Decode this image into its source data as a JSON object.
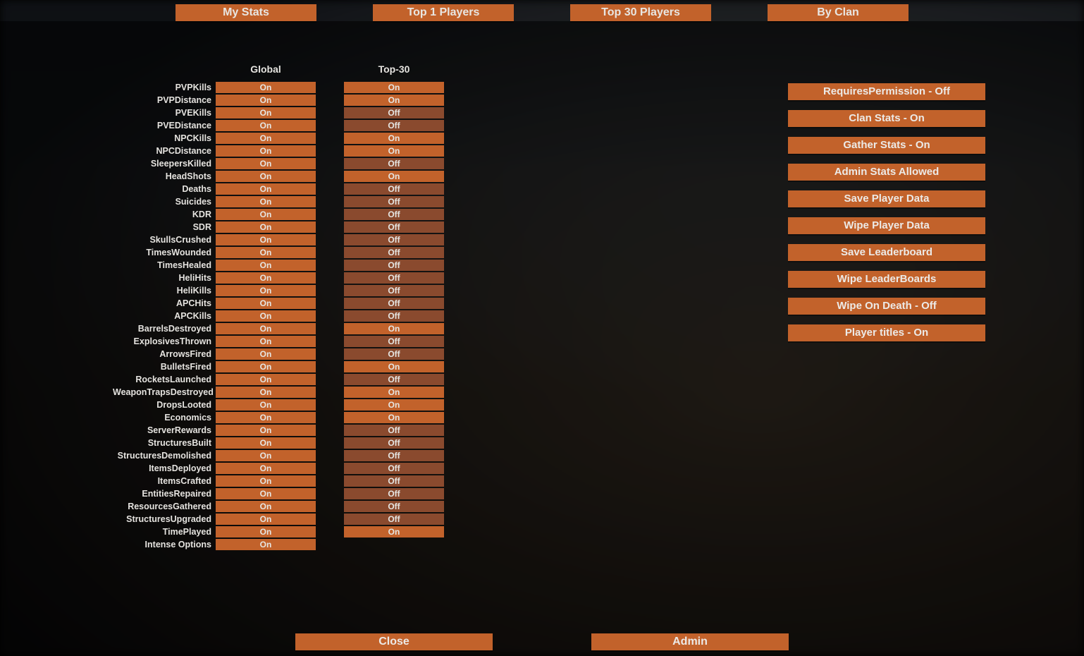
{
  "tabs": [
    {
      "id": "my-stats",
      "label": "My Stats"
    },
    {
      "id": "top-1",
      "label": "Top 1 Players"
    },
    {
      "id": "top-30",
      "label": "Top 30 Players"
    },
    {
      "id": "by-clan",
      "label": "By Clan"
    }
  ],
  "columns": {
    "global": "Global",
    "top30": "Top-30"
  },
  "stats": [
    {
      "name": "PVPKills",
      "global": "On",
      "top30": "On"
    },
    {
      "name": "PVPDistance",
      "global": "On",
      "top30": "On"
    },
    {
      "name": "PVEKills",
      "global": "On",
      "top30": "Off"
    },
    {
      "name": "PVEDistance",
      "global": "On",
      "top30": "Off"
    },
    {
      "name": "NPCKills",
      "global": "On",
      "top30": "On"
    },
    {
      "name": "NPCDistance",
      "global": "On",
      "top30": "On"
    },
    {
      "name": "SleepersKilled",
      "global": "On",
      "top30": "Off"
    },
    {
      "name": "HeadShots",
      "global": "On",
      "top30": "On"
    },
    {
      "name": "Deaths",
      "global": "On",
      "top30": "Off"
    },
    {
      "name": "Suicides",
      "global": "On",
      "top30": "Off"
    },
    {
      "name": "KDR",
      "global": "On",
      "top30": "Off"
    },
    {
      "name": "SDR",
      "global": "On",
      "top30": "Off"
    },
    {
      "name": "SkullsCrushed",
      "global": "On",
      "top30": "Off"
    },
    {
      "name": "TimesWounded",
      "global": "On",
      "top30": "Off"
    },
    {
      "name": "TimesHealed",
      "global": "On",
      "top30": "Off"
    },
    {
      "name": "HeliHits",
      "global": "On",
      "top30": "Off"
    },
    {
      "name": "HeliKills",
      "global": "On",
      "top30": "Off"
    },
    {
      "name": "APCHits",
      "global": "On",
      "top30": "Off"
    },
    {
      "name": "APCKills",
      "global": "On",
      "top30": "Off"
    },
    {
      "name": "BarrelsDestroyed",
      "global": "On",
      "top30": "On"
    },
    {
      "name": "ExplosivesThrown",
      "global": "On",
      "top30": "Off"
    },
    {
      "name": "ArrowsFired",
      "global": "On",
      "top30": "Off"
    },
    {
      "name": "BulletsFired",
      "global": "On",
      "top30": "On"
    },
    {
      "name": "RocketsLaunched",
      "global": "On",
      "top30": "Off"
    },
    {
      "name": "WeaponTrapsDestroyed",
      "global": "On",
      "top30": "On"
    },
    {
      "name": "DropsLooted",
      "global": "On",
      "top30": "On"
    },
    {
      "name": "Economics",
      "global": "On",
      "top30": "On"
    },
    {
      "name": "ServerRewards",
      "global": "On",
      "top30": "Off"
    },
    {
      "name": "StructuresBuilt",
      "global": "On",
      "top30": "Off"
    },
    {
      "name": "StructuresDemolished",
      "global": "On",
      "top30": "Off"
    },
    {
      "name": "ItemsDeployed",
      "global": "On",
      "top30": "Off"
    },
    {
      "name": "ItemsCrafted",
      "global": "On",
      "top30": "Off"
    },
    {
      "name": "EntitiesRepaired",
      "global": "On",
      "top30": "Off"
    },
    {
      "name": "ResourcesGathered",
      "global": "On",
      "top30": "Off"
    },
    {
      "name": "StructuresUpgraded",
      "global": "On",
      "top30": "Off"
    },
    {
      "name": "TimePlayed",
      "global": "On",
      "top30": "On"
    },
    {
      "name": "Intense Options",
      "global": "On",
      "top30": null
    }
  ],
  "admin_buttons": [
    {
      "id": "requires-permission",
      "label": "RequiresPermission - Off"
    },
    {
      "id": "clan-stats",
      "label": "Clan Stats - On"
    },
    {
      "id": "gather-stats",
      "label": "Gather Stats - On"
    },
    {
      "id": "admin-stats",
      "label": "Admin Stats Allowed"
    },
    {
      "id": "save-player-data",
      "label": "Save Player Data"
    },
    {
      "id": "wipe-player-data",
      "label": "Wipe Player Data"
    },
    {
      "id": "save-leaderboard",
      "label": "Save Leaderboard"
    },
    {
      "id": "wipe-leaderboards",
      "label": "Wipe LeaderBoards"
    },
    {
      "id": "wipe-on-death",
      "label": "Wipe On Death - Off"
    },
    {
      "id": "player-titles",
      "label": "Player titles - On"
    }
  ],
  "bottom": {
    "close": "Close",
    "admin": "Admin"
  }
}
